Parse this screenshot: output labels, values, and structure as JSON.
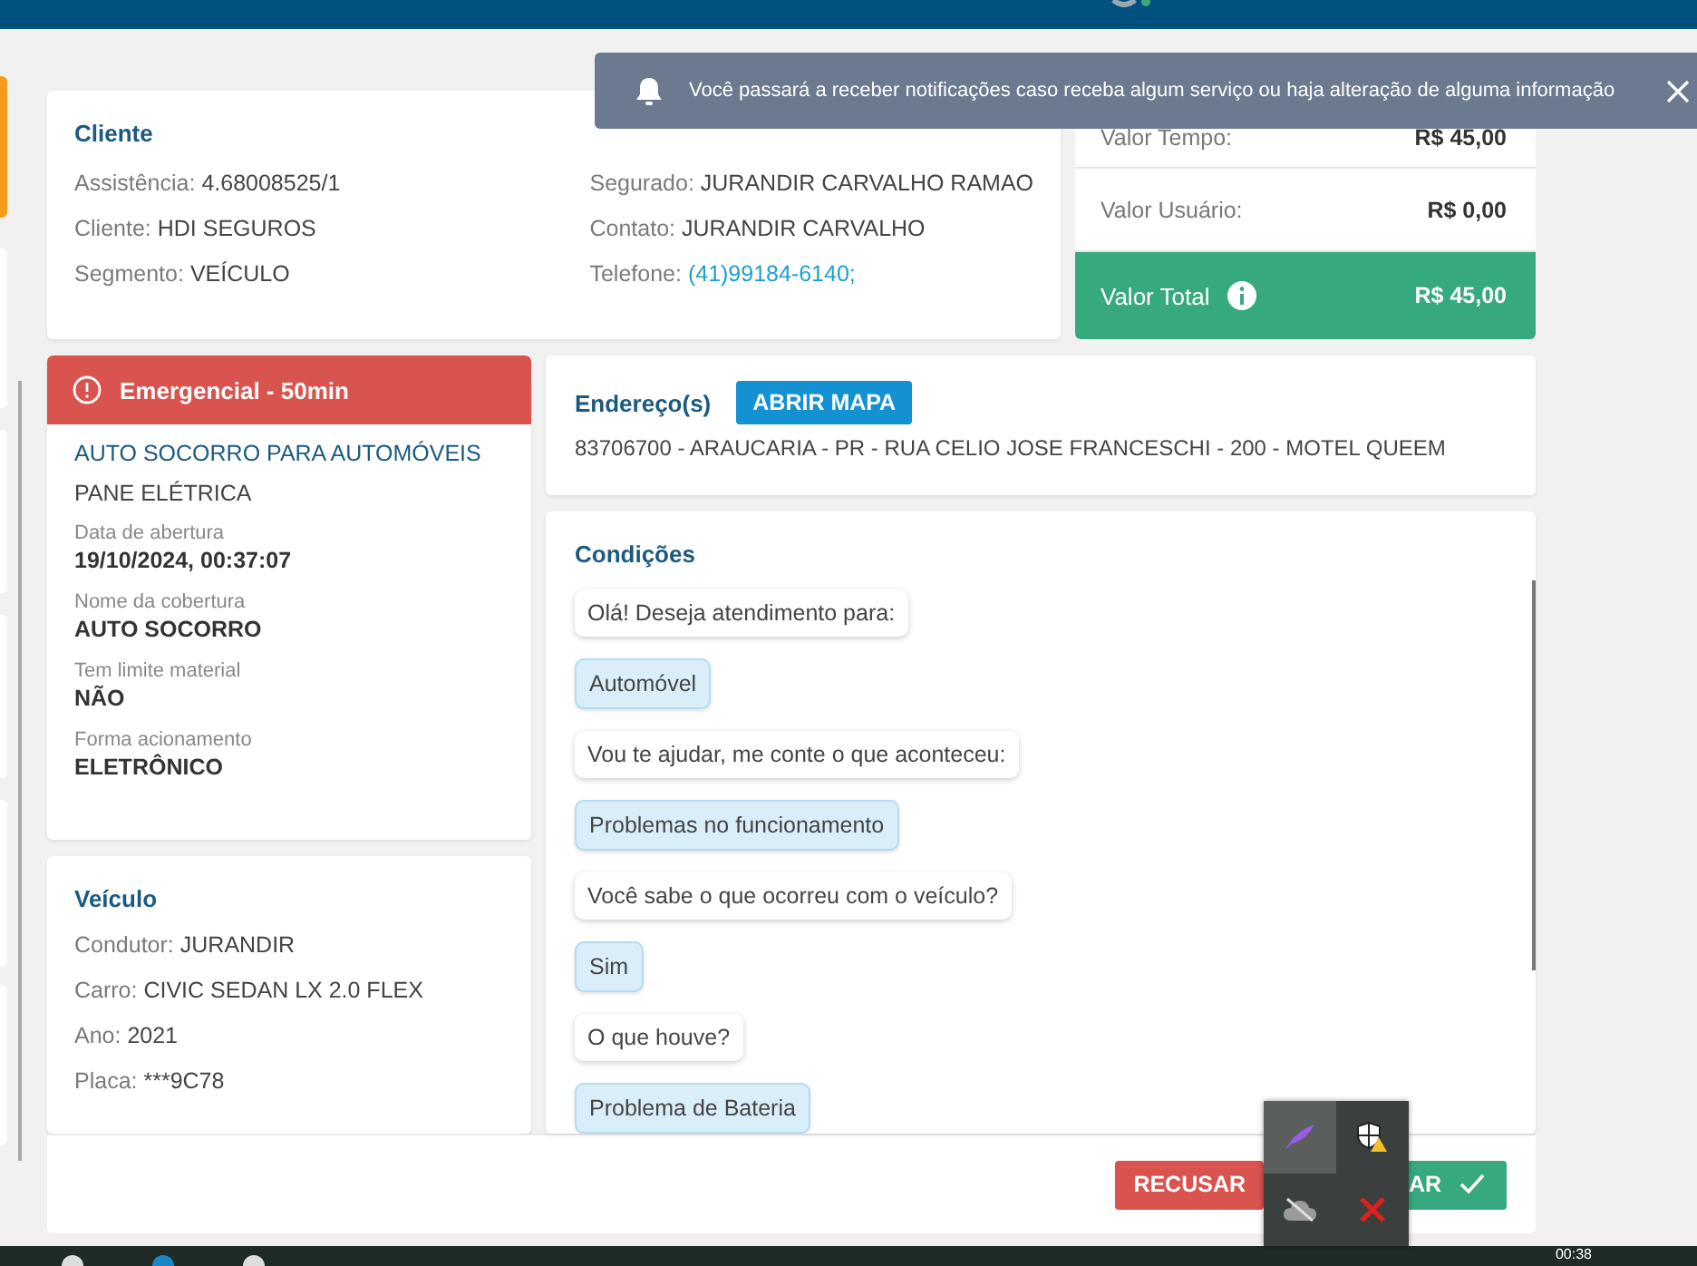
{
  "sidebar": {
    "items": [
      {
        "selected": true
      },
      {
        "selected": false
      },
      {
        "selected": false
      },
      {
        "selected": false
      },
      {
        "selected": false
      },
      {
        "selected": false
      }
    ]
  },
  "notification": {
    "message": "Você passará a receber notificações caso receba algum serviço ou haja alteração de alguma informação"
  },
  "client": {
    "title": "Cliente",
    "fields_left": [
      {
        "label": "Assistência:",
        "value": "4.68008525/1"
      },
      {
        "label": "Cliente:",
        "value": "HDI SEGUROS"
      },
      {
        "label": "Segmento:",
        "value": "VEÍCULO"
      }
    ],
    "fields_right": [
      {
        "label": "Segurado:",
        "value": "JURANDIR CARVALHO RAMAO",
        "kind": "text"
      },
      {
        "label": "Contato:",
        "value": "JURANDIR CARVALHO",
        "kind": "text"
      },
      {
        "label": "Telefone:",
        "value": "(41)99184-6140;",
        "kind": "link"
      }
    ]
  },
  "values": [
    {
      "label": "Valor Tempo:",
      "amount": "R$ 45,00",
      "kind": "plain"
    },
    {
      "label": "Valor Usuário:",
      "amount": "R$ 0,00",
      "kind": "plain"
    },
    {
      "label": "Valor Total",
      "amount": "R$ 45,00",
      "kind": "total"
    }
  ],
  "service": {
    "priority": "Emergencial - 50min",
    "title": "AUTO SOCORRO PARA AUTOMÓVEIS",
    "subtitle": "PANE ELÉTRICA",
    "details": [
      {
        "label": "Data de abertura",
        "value": "19/10/2024, 00:37:07"
      },
      {
        "label": "Nome da cobertura",
        "value": "AUTO SOCORRO"
      },
      {
        "label": "Tem limite material",
        "value": "NÃO"
      },
      {
        "label": "Forma acionamento",
        "value": "ELETRÔNICO"
      }
    ]
  },
  "vehicle": {
    "title": "Veículo",
    "fields": [
      {
        "label": "Condutor:",
        "value": "JURANDIR"
      },
      {
        "label": "Carro:",
        "value": "CIVIC SEDAN LX 2.0 FLEX"
      },
      {
        "label": "Ano:",
        "value": "2021"
      },
      {
        "label": "Placa:",
        "value": "***9C78"
      }
    ]
  },
  "address": {
    "title": "Endereço(s)",
    "button": "ABRIR MAPA",
    "text": "83706700 - ARAUCARIA - PR - RUA CELIO JOSE FRANCESCHI - 200 - MOTEL QUEEM"
  },
  "conditions": {
    "title": "Condições",
    "messages": [
      {
        "text": "Olá! Deseja atendimento para:",
        "kind": "question"
      },
      {
        "text": "Automóvel",
        "kind": "answer"
      },
      {
        "text": "Vou te ajudar, me conte o que aconteceu:",
        "kind": "question"
      },
      {
        "text": "Problemas no funcionamento",
        "kind": "answer"
      },
      {
        "text": "Você sabe o que ocorreu com o veículo?",
        "kind": "question"
      },
      {
        "text": "Sim",
        "kind": "answer"
      },
      {
        "text": "O que houve?",
        "kind": "question"
      },
      {
        "text": "Problema de Bateria",
        "kind": "answer"
      }
    ]
  },
  "actions": [
    {
      "label": "RECUSAR",
      "kind": "reject"
    },
    {
      "label": "AR",
      "kind": "accept"
    }
  ],
  "taskbar": {
    "clock": "00:38"
  }
}
